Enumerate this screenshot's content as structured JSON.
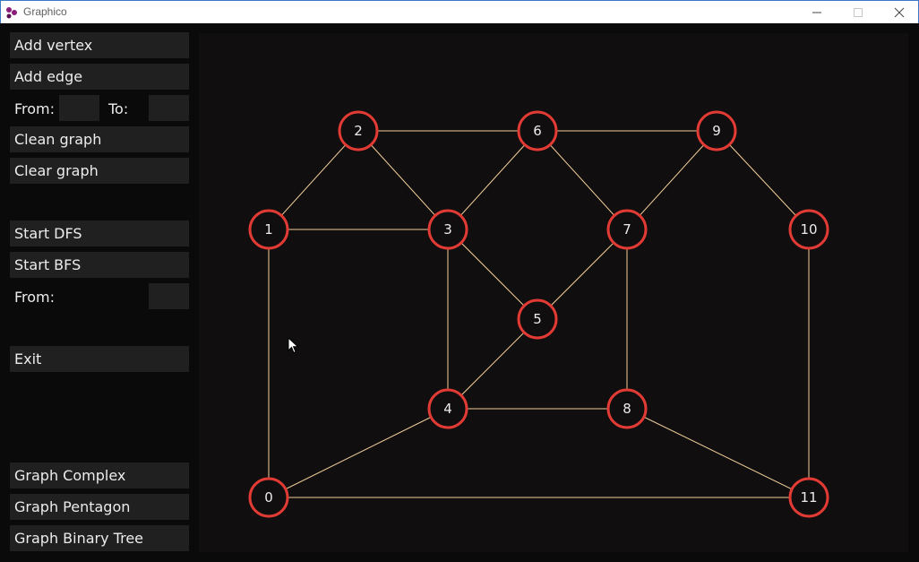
{
  "window": {
    "title": "Graphico",
    "icon": "graph-logo-icon",
    "controls": [
      "minimize-icon",
      "maximize-icon",
      "close-icon"
    ]
  },
  "sidebar": {
    "add_vertex": "Add vertex",
    "add_edge": "Add edge",
    "from_label": "From:",
    "from_value": "",
    "to_label": "To:",
    "to_value": "",
    "clean_graph": "Clean graph",
    "clear_graph": "Clear graph",
    "start_dfs": "Start DFS",
    "start_bfs": "Start BFS",
    "search_from_label": "From:",
    "search_from_value": "",
    "exit": "Exit",
    "graph_complex": "Graph Complex",
    "graph_pentagon": "Graph Pentagon",
    "graph_binary_tree": "Graph Binary Tree"
  },
  "graph": {
    "vertices": [
      "0",
      "1",
      "2",
      "3",
      "4",
      "5",
      "6",
      "7",
      "8",
      "9",
      "10",
      "11"
    ],
    "edges": [
      [
        "1",
        "2"
      ],
      [
        "2",
        "3"
      ],
      [
        "1",
        "3"
      ],
      [
        "2",
        "6"
      ],
      [
        "6",
        "3"
      ],
      [
        "6",
        "7"
      ],
      [
        "6",
        "9"
      ],
      [
        "9",
        "7"
      ],
      [
        "9",
        "10"
      ],
      [
        "3",
        "5"
      ],
      [
        "7",
        "5"
      ],
      [
        "3",
        "4"
      ],
      [
        "5",
        "4"
      ],
      [
        "7",
        "8"
      ],
      [
        "4",
        "8"
      ],
      [
        "1",
        "0"
      ],
      [
        "0",
        "4"
      ],
      [
        "0",
        "11"
      ],
      [
        "8",
        "11"
      ],
      [
        "10",
        "11"
      ]
    ]
  },
  "colors": {
    "vertex_outline": "#e23a34",
    "edge": "#f2cf9a",
    "canvas_background": "#100e0e",
    "button_background": "#202020",
    "text": "#ececec"
  }
}
